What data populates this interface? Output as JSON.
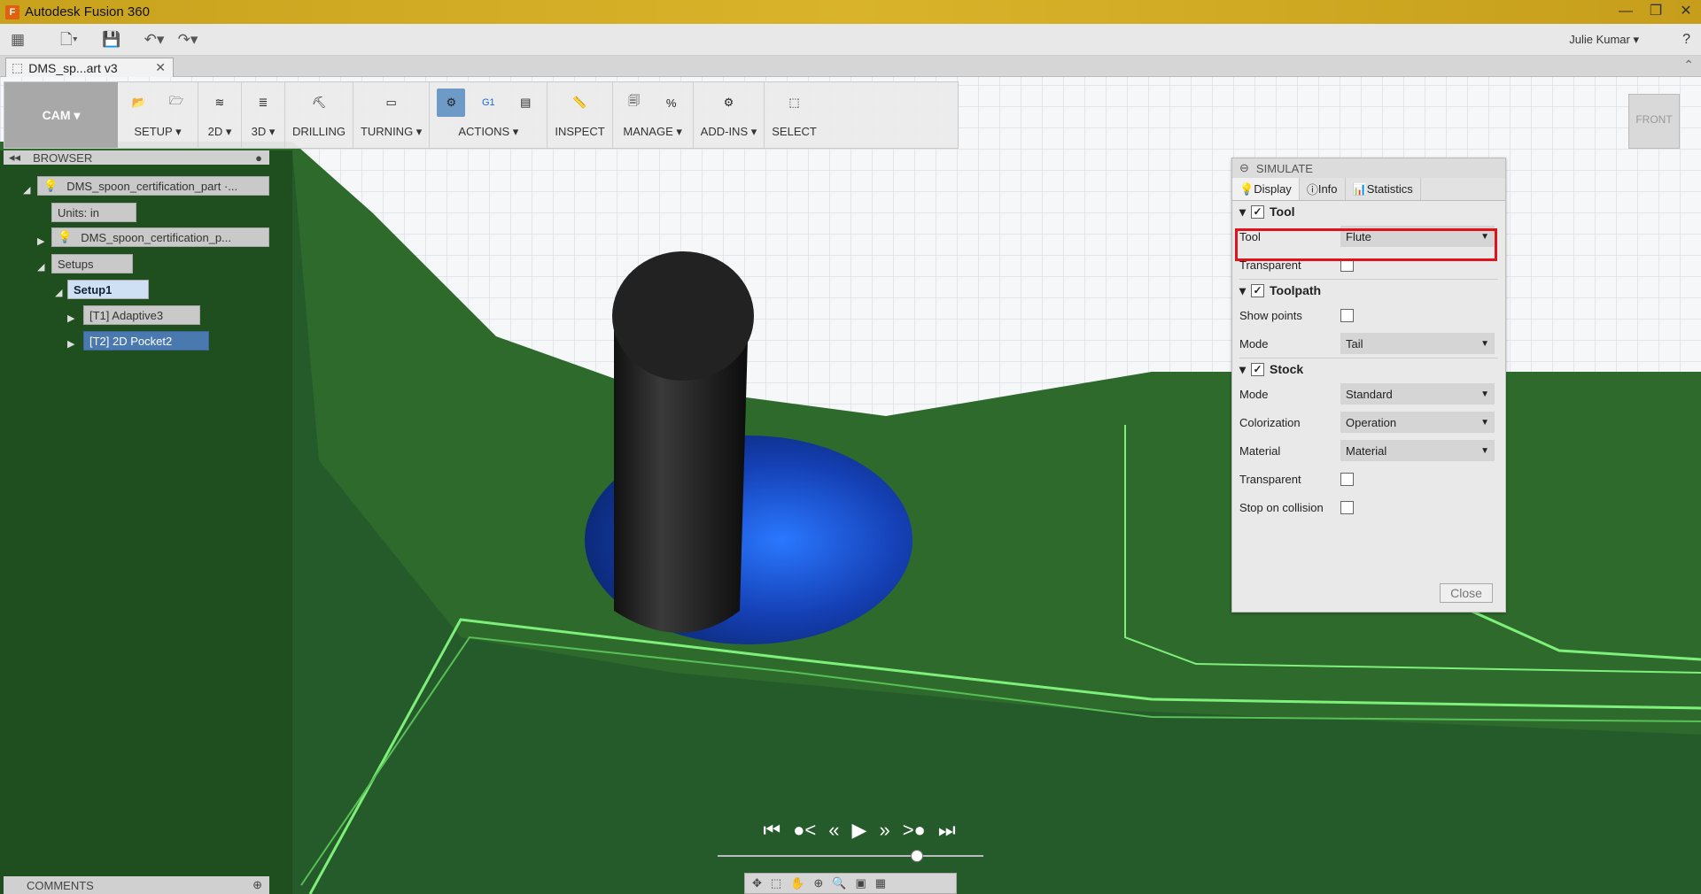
{
  "window": {
    "title": "Autodesk Fusion 360",
    "controls": [
      "—",
      "❐",
      "✕"
    ]
  },
  "qat": {
    "user": "Julie Kumar ▾",
    "help": "?"
  },
  "doc_tab": {
    "label": "DMS_sp...art v3"
  },
  "toolbar": {
    "workspace": "CAM ▾",
    "groups": [
      {
        "label": "SETUP ▾"
      },
      {
        "label": "2D ▾"
      },
      {
        "label": "3D ▾"
      },
      {
        "label": "DRILLING"
      },
      {
        "label": "TURNING ▾"
      },
      {
        "label": "ACTIONS ▾"
      },
      {
        "label": "INSPECT"
      },
      {
        "label": "MANAGE ▾"
      },
      {
        "label": "ADD-INS ▾"
      },
      {
        "label": "SELECT"
      }
    ]
  },
  "browser": {
    "header": "BROWSER",
    "nodes": {
      "root": "DMS_spoon_certification_part ·...",
      "units": "Units: in",
      "body": "DMS_spoon_certification_p...",
      "setups": "Setups",
      "setup1": "Setup1",
      "op1": "[T1] Adaptive3",
      "op2": "[T2] 2D Pocket2"
    }
  },
  "comments": {
    "label": "COMMENTS"
  },
  "simulate": {
    "title": "SIMULATE",
    "tabs": [
      "Display",
      "Info",
      "Statistics"
    ],
    "tool_section": "Tool",
    "tool_label": "Tool",
    "tool_value": "Flute",
    "transparent_label": "Transparent",
    "toolpath_section": "Toolpath",
    "show_points_label": "Show points",
    "tp_mode_label": "Mode",
    "tp_mode_value": "Tail",
    "stock_section": "Stock",
    "stock_mode_label": "Mode",
    "stock_mode_value": "Standard",
    "colorization_label": "Colorization",
    "colorization_value": "Operation",
    "material_label": "Material",
    "material_value": "Material",
    "stock_transparent_label": "Transparent",
    "stop_label": "Stop on collision",
    "close": "Close"
  },
  "viewcube": {
    "label": "FRONT"
  },
  "colors": {
    "accent": "#e0121b",
    "stock": "#2c612b",
    "tool": "#1b1b1b",
    "cut": "#1846c8"
  }
}
